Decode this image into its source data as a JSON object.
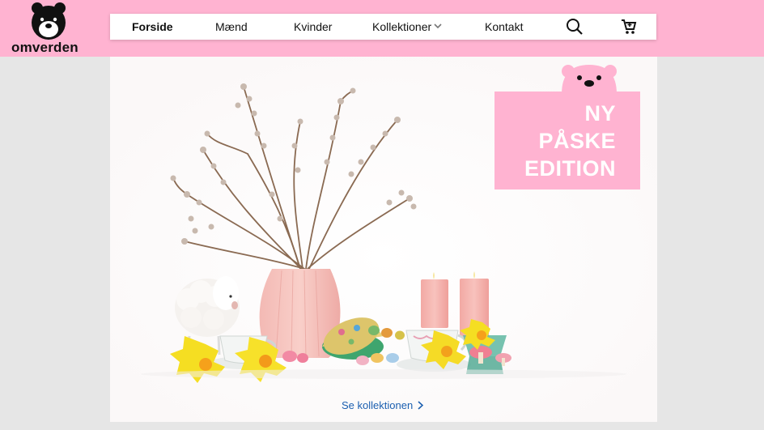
{
  "brand": {
    "logo_text": "omverden"
  },
  "nav": {
    "items": [
      {
        "label": "Forside"
      },
      {
        "label": "Mænd"
      },
      {
        "label": "Kvinder"
      },
      {
        "label": "Kollektioner"
      },
      {
        "label": "Kontakt"
      }
    ],
    "icons": [
      "search-icon",
      "cart-icon"
    ]
  },
  "hero": {
    "badge_lines": [
      "NY",
      "PÅSKE",
      "EDITION"
    ],
    "cta_label": "Se kollektionen"
  },
  "colors": {
    "topbar": "#ffb3d1",
    "badge": "#ffb3d1",
    "link": "#1b5fb0"
  }
}
